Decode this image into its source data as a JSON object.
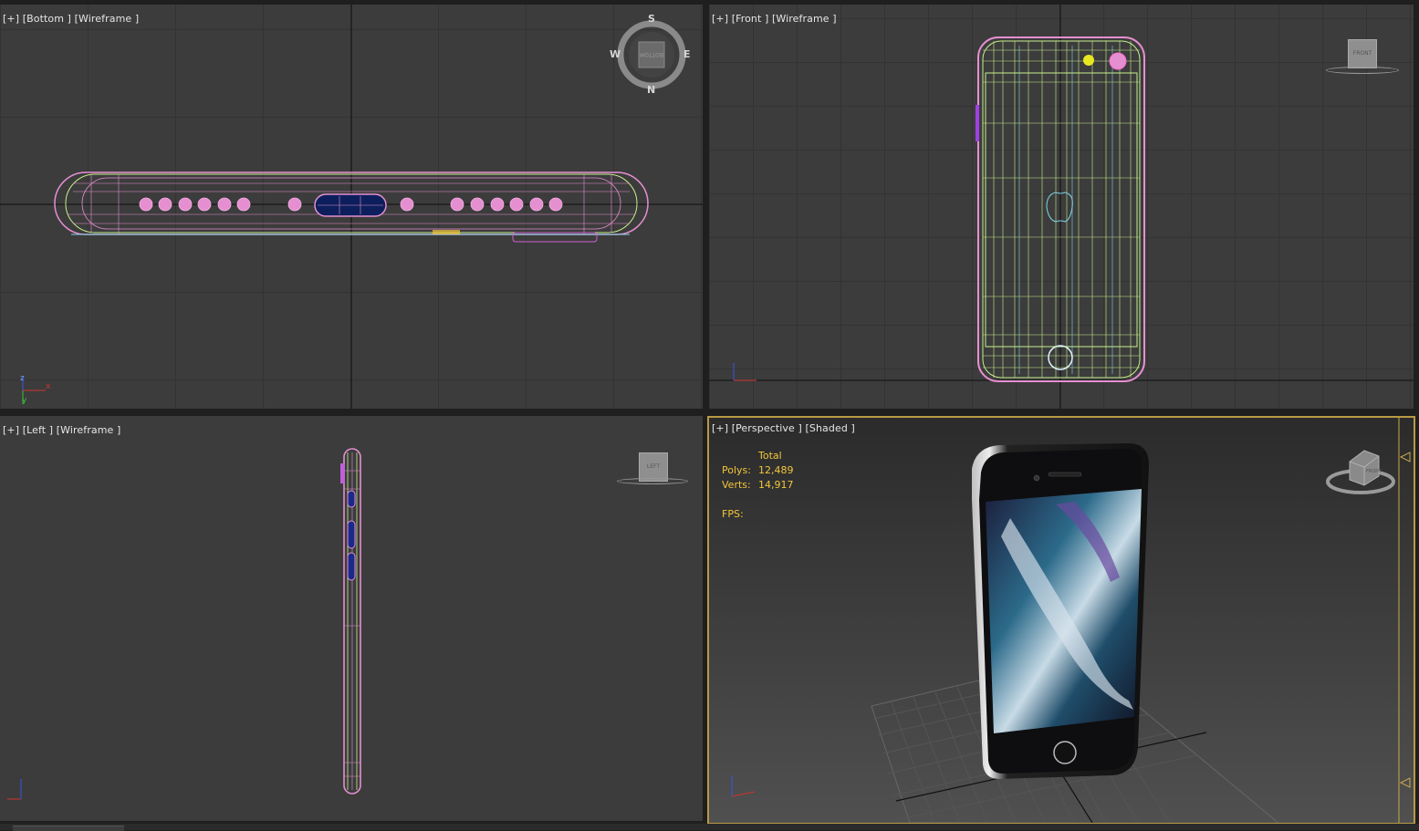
{
  "viewports": [
    {
      "id": "bottom",
      "label": "[+] [Bottom ] [Wireframe ]",
      "navigator": "view-compass",
      "compass": {
        "top": "S",
        "bottom": "N",
        "left": "W",
        "right": "E",
        "center": "BOTTOM"
      }
    },
    {
      "id": "front",
      "label": "[+] [Front ] [Wireframe ]",
      "navigator": "view-cube",
      "cube_face": "FRONT"
    },
    {
      "id": "left",
      "label": "[+] [Left ] [Wireframe ]",
      "navigator": "view-cube",
      "cube_face": "LEFT"
    },
    {
      "id": "perspective",
      "label": "[+] [Perspective ] [Shaded ]",
      "navigator": "view-cube",
      "cube_face": "FRONT",
      "active": true
    }
  ],
  "stats": {
    "header": "Total",
    "polys_label": "Polys:",
    "polys_value": "12,489",
    "verts_label": "Verts:",
    "verts_value": "14,917",
    "fps_label": "FPS:"
  },
  "axis_tripod": {
    "x": "x",
    "y": "y",
    "z": "z"
  },
  "colors": {
    "viewport_bg": "#3c3c3c",
    "grid": "#333333",
    "grid_axis": "#111111",
    "wire_pink": "#e58fd0",
    "wire_green": "#c8f08c",
    "wire_blue": "#7fd4e6",
    "active_border": "#b89a43",
    "stats_text": "#f3c63a"
  }
}
